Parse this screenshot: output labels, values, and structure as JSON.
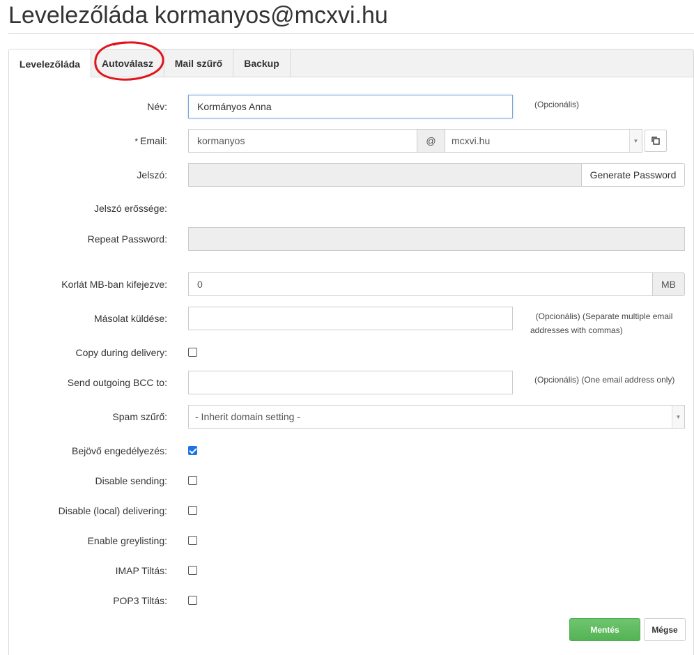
{
  "page": {
    "title": "Levelezőláda kormanyos@mcxvi.hu"
  },
  "tabs": [
    "Levelezőláda",
    "Autoválasz",
    "Mail szűrő",
    "Backup"
  ],
  "form": {
    "name": {
      "label": "Név:",
      "value": "Kormányos Anna",
      "hint": "(Opcionális)"
    },
    "email": {
      "required_mark": "*",
      "label": "Email:",
      "local": "kormanyos",
      "at": "@",
      "domain": "mcxvi.hu"
    },
    "password": {
      "label": "Jelszó:",
      "generate_label": "Generate Password"
    },
    "strength": {
      "label": "Jelszó erőssége:"
    },
    "repeat": {
      "label": "Repeat Password:"
    },
    "quota": {
      "label": "Korlát MB-ban kifejezve:",
      "value": "0",
      "unit": "MB"
    },
    "copy_to": {
      "label": "Másolat küldése:",
      "hint_line1": "(Opcionális) (Separate multiple email",
      "hint_line2": "addresses with commas)"
    },
    "copy_during": {
      "label": "Copy during delivery:",
      "checked": false
    },
    "bcc": {
      "label": "Send outgoing BCC to:",
      "hint": "(Opcionális) (One email address only)"
    },
    "spam": {
      "label": "Spam szűrő:",
      "value": "- Inherit domain setting -"
    },
    "incoming": {
      "label": "Bejövő engedélyezés:",
      "checked": true
    },
    "disable_sending": {
      "label": "Disable sending:",
      "checked": false
    },
    "disable_local": {
      "label": "Disable (local) delivering:",
      "checked": false
    },
    "greylisting": {
      "label": "Enable greylisting:",
      "checked": false
    },
    "imap": {
      "label": "IMAP Tiltás:",
      "checked": false
    },
    "pop3": {
      "label": "POP3 Tiltás:",
      "checked": false
    }
  },
  "actions": {
    "save": "Mentés",
    "cancel": "Mégse"
  },
  "colors": {
    "save_green": "#5cb85c",
    "annotation_red": "#e0141c",
    "checkbox_blue": "#1a73e8"
  }
}
